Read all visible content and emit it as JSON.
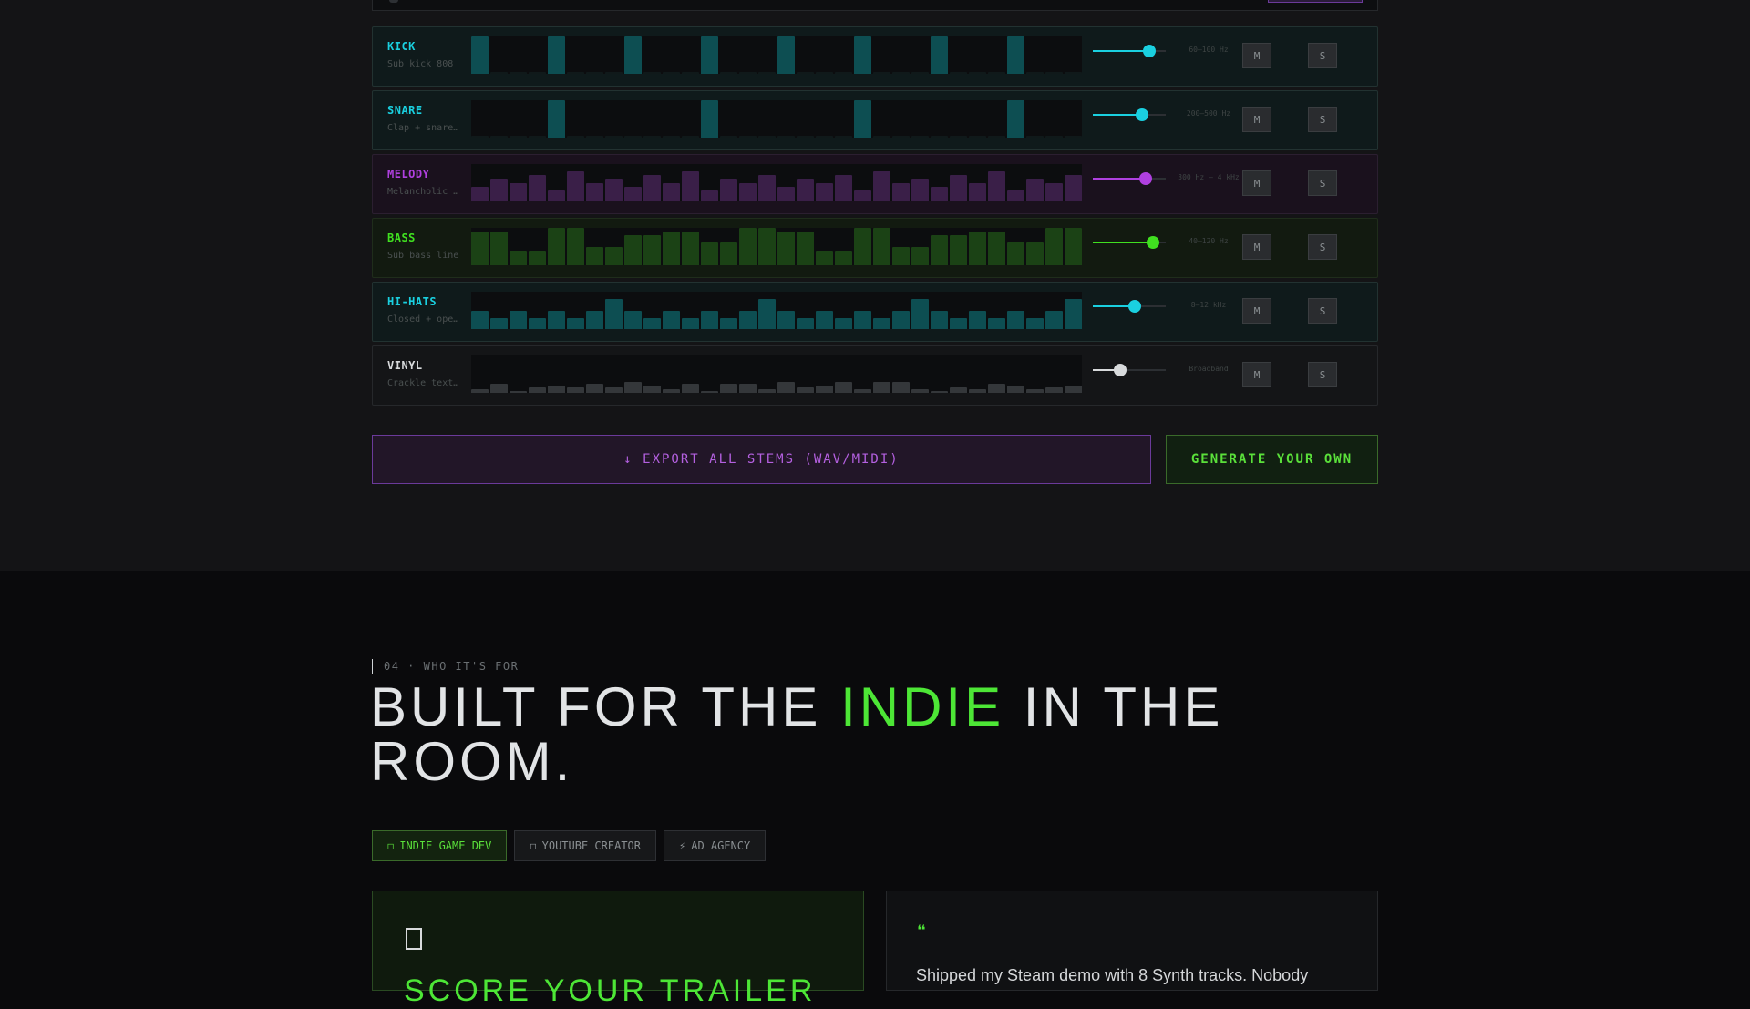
{
  "tracks": [
    {
      "id": "kick",
      "name": "KICK",
      "desc": "Sub kick 808",
      "freq": "60–100 Hz",
      "color": "#1ad0e0",
      "bar_color": "#0d4e52",
      "volume": 0.78,
      "steps": [
        1,
        0,
        0,
        0,
        1,
        0,
        0,
        0,
        1,
        0,
        0,
        0,
        1,
        0,
        0,
        0,
        1,
        0,
        0,
        0,
        1,
        0,
        0,
        0,
        1,
        0,
        0,
        0,
        1,
        0,
        0,
        0
      ]
    },
    {
      "id": "snare",
      "name": "SNARE",
      "desc": "Clap + snare...",
      "freq": "200–500 Hz",
      "color": "#1ad0e0",
      "bar_color": "#0d4e52",
      "volume": 0.68,
      "steps": [
        0,
        0,
        0,
        0,
        1,
        0,
        0,
        0,
        0,
        0,
        0,
        0,
        1,
        0,
        0,
        0,
        0,
        0,
        0,
        0,
        1,
        0,
        0,
        0,
        0,
        0,
        0,
        0,
        1,
        0,
        0,
        0
      ]
    },
    {
      "id": "melody",
      "name": "MELODY",
      "desc": "Melancholic ...",
      "freq": "300 Hz – 4 kHz",
      "color": "#b040e0",
      "bar_color": "#3a1f48",
      "volume": 0.73,
      "steps": [
        0.4,
        0.6,
        0.5,
        0.7,
        0.3,
        0.8,
        0.5,
        0.6,
        0.4,
        0.7,
        0.5,
        0.8,
        0.3,
        0.6,
        0.5,
        0.7,
        0.4,
        0.6,
        0.5,
        0.7,
        0.3,
        0.8,
        0.5,
        0.6,
        0.4,
        0.7,
        0.5,
        0.8,
        0.3,
        0.6,
        0.5,
        0.7
      ]
    },
    {
      "id": "bass",
      "name": "BASS",
      "desc": "Sub bass line",
      "freq": "40–120 Hz",
      "color": "#40e020",
      "bar_color": "#1b4215",
      "volume": 0.83,
      "steps": [
        0.9,
        0.9,
        0.4,
        0.4,
        1,
        1,
        0.5,
        0.5,
        0.8,
        0.8,
        0.9,
        0.9,
        0.6,
        0.6,
        1,
        1,
        0.9,
        0.9,
        0.4,
        0.4,
        1,
        1,
        0.5,
        0.5,
        0.8,
        0.8,
        0.9,
        0.9,
        0.6,
        0.6,
        1,
        1
      ]
    },
    {
      "id": "hihats",
      "name": "HI-HATS",
      "desc": "Closed + ope...",
      "freq": "8–12 kHz",
      "color": "#1ad0e0",
      "bar_color": "#0d4e52",
      "volume": 0.58,
      "steps": [
        0.5,
        0.3,
        0.5,
        0.3,
        0.5,
        0.3,
        0.5,
        0.8,
        0.5,
        0.3,
        0.5,
        0.3,
        0.5,
        0.3,
        0.5,
        0.8,
        0.5,
        0.3,
        0.5,
        0.3,
        0.5,
        0.3,
        0.5,
        0.8,
        0.5,
        0.3,
        0.5,
        0.3,
        0.5,
        0.3,
        0.5,
        0.8
      ]
    },
    {
      "id": "vinyl",
      "name": "VINYL",
      "desc": "Crackle text...",
      "freq": "Broadband",
      "color": "#d8dadc",
      "bar_color": "#34373a",
      "volume": 0.38,
      "steps": [
        0.1,
        0.25,
        0.05,
        0.15,
        0.2,
        0.15,
        0.25,
        0.15,
        0.3,
        0.2,
        0.1,
        0.25,
        0.05,
        0.25,
        0.25,
        0.1,
        0.3,
        0.15,
        0.2,
        0.3,
        0.1,
        0.3,
        0.3,
        0.1,
        0.05,
        0.15,
        0.1,
        0.25,
        0.2,
        0.1,
        0.15,
        0.2
      ]
    }
  ],
  "mute_label": "M",
  "solo_label": "S",
  "actions": {
    "export_label": "↓ EXPORT ALL STEMS (WAV/MIDI)",
    "generate_label": "GENERATE YOUR OWN"
  },
  "who_section": {
    "label": "04 · WHO IT'S FOR",
    "headline_before": "BUILT FOR THE ",
    "headline_accent": "INDIE",
    "headline_after": " IN THE ROOM.",
    "tabs": [
      {
        "icon": "◻",
        "label": "INDIE GAME DEV",
        "active": true
      },
      {
        "icon": "◻",
        "label": "YOUTUBE CREATOR",
        "active": false
      },
      {
        "icon": "⚡",
        "label": "AD AGENCY",
        "active": false
      }
    ],
    "card_title": "SCORE YOUR TRAILER",
    "quote_mark": "❝",
    "quote_text": "Shipped my Steam demo with 8 Synth tracks. Nobody"
  },
  "colors": {
    "accent_green": "#4de636",
    "accent_purple": "#b460e0",
    "accent_cyan": "#1ad0e0"
  }
}
